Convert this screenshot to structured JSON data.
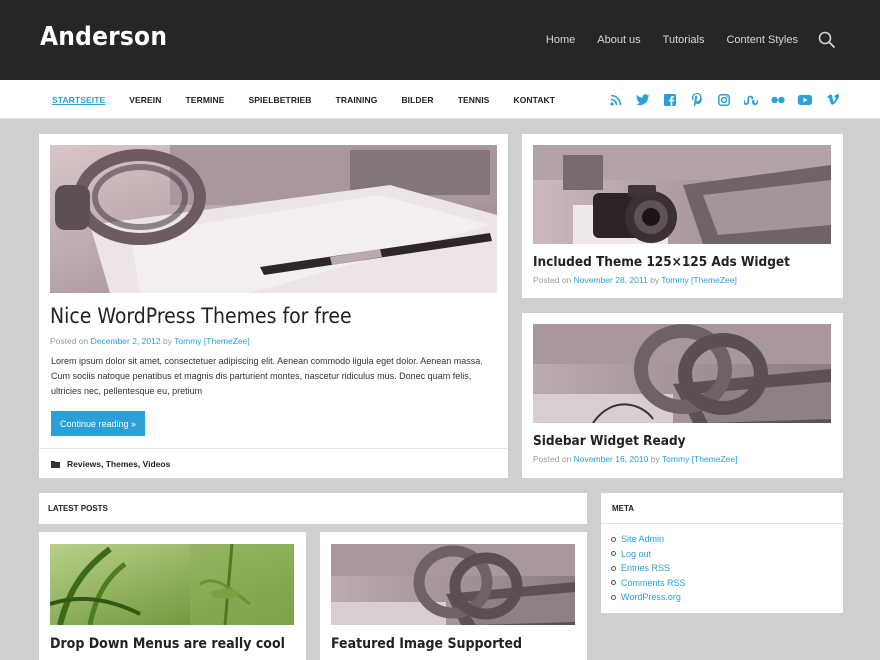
{
  "site": {
    "title": "Anderson"
  },
  "top_nav": [
    "Home",
    "About us",
    "Tutorials",
    "Content Styles"
  ],
  "main_menu": [
    "STARTSEITE",
    "VEREIN",
    "TERMINE",
    "SPIELBETRIEB",
    "TRAINING",
    "BILDER",
    "TENNIS",
    "KONTAKT"
  ],
  "social_icons": [
    "rss-icon",
    "twitter-icon",
    "facebook-icon",
    "pinterest-icon",
    "instagram-icon",
    "stumbleupon-icon",
    "flickr-icon",
    "youtube-icon",
    "vimeo-icon"
  ],
  "featured_post": {
    "title": "Nice WordPress Themes for free",
    "posted_on": "Posted on",
    "date": "December 2, 2012",
    "by": "by",
    "author": "Tommy [ThemeZee]",
    "excerpt": "Lorem ipsum dolor sit amet, consectetuer adipiscing elit. Aenean commodo ligula eget dolor. Aenean massa. Cum sociis natoque penatibus et magnis dis parturient montes, nascetur ridiculus mus. Donec quam felis, ultricies nec, pellentesque eu, pretium",
    "button": "Continue reading »",
    "categories": "Reviews, Themes, Videos"
  },
  "side_posts": [
    {
      "title": "Included Theme 125×125 Ads Widget",
      "posted_on": "Posted on",
      "date": "November 28, 2011",
      "by": "by",
      "author": "Tommy [ThemeZee]"
    },
    {
      "title": "Sidebar Widget Ready",
      "posted_on": "Posted on",
      "date": "November 16, 2010",
      "by": "by",
      "author": "Tommy [ThemeZee]"
    }
  ],
  "latest_posts": {
    "heading": "LATEST POSTS",
    "items": [
      {
        "title": "Drop Down Menus are really cool"
      },
      {
        "title": "Featured Image Supported"
      }
    ]
  },
  "meta_widget": {
    "heading": "META",
    "links": [
      "Site Admin",
      "Log out",
      "Entries RSS",
      "Comments RSS",
      "WordPress.org"
    ]
  },
  "colors": {
    "accent": "#2aa0d6",
    "header_bg": "#262626",
    "page_bg": "#cfcfcf"
  }
}
